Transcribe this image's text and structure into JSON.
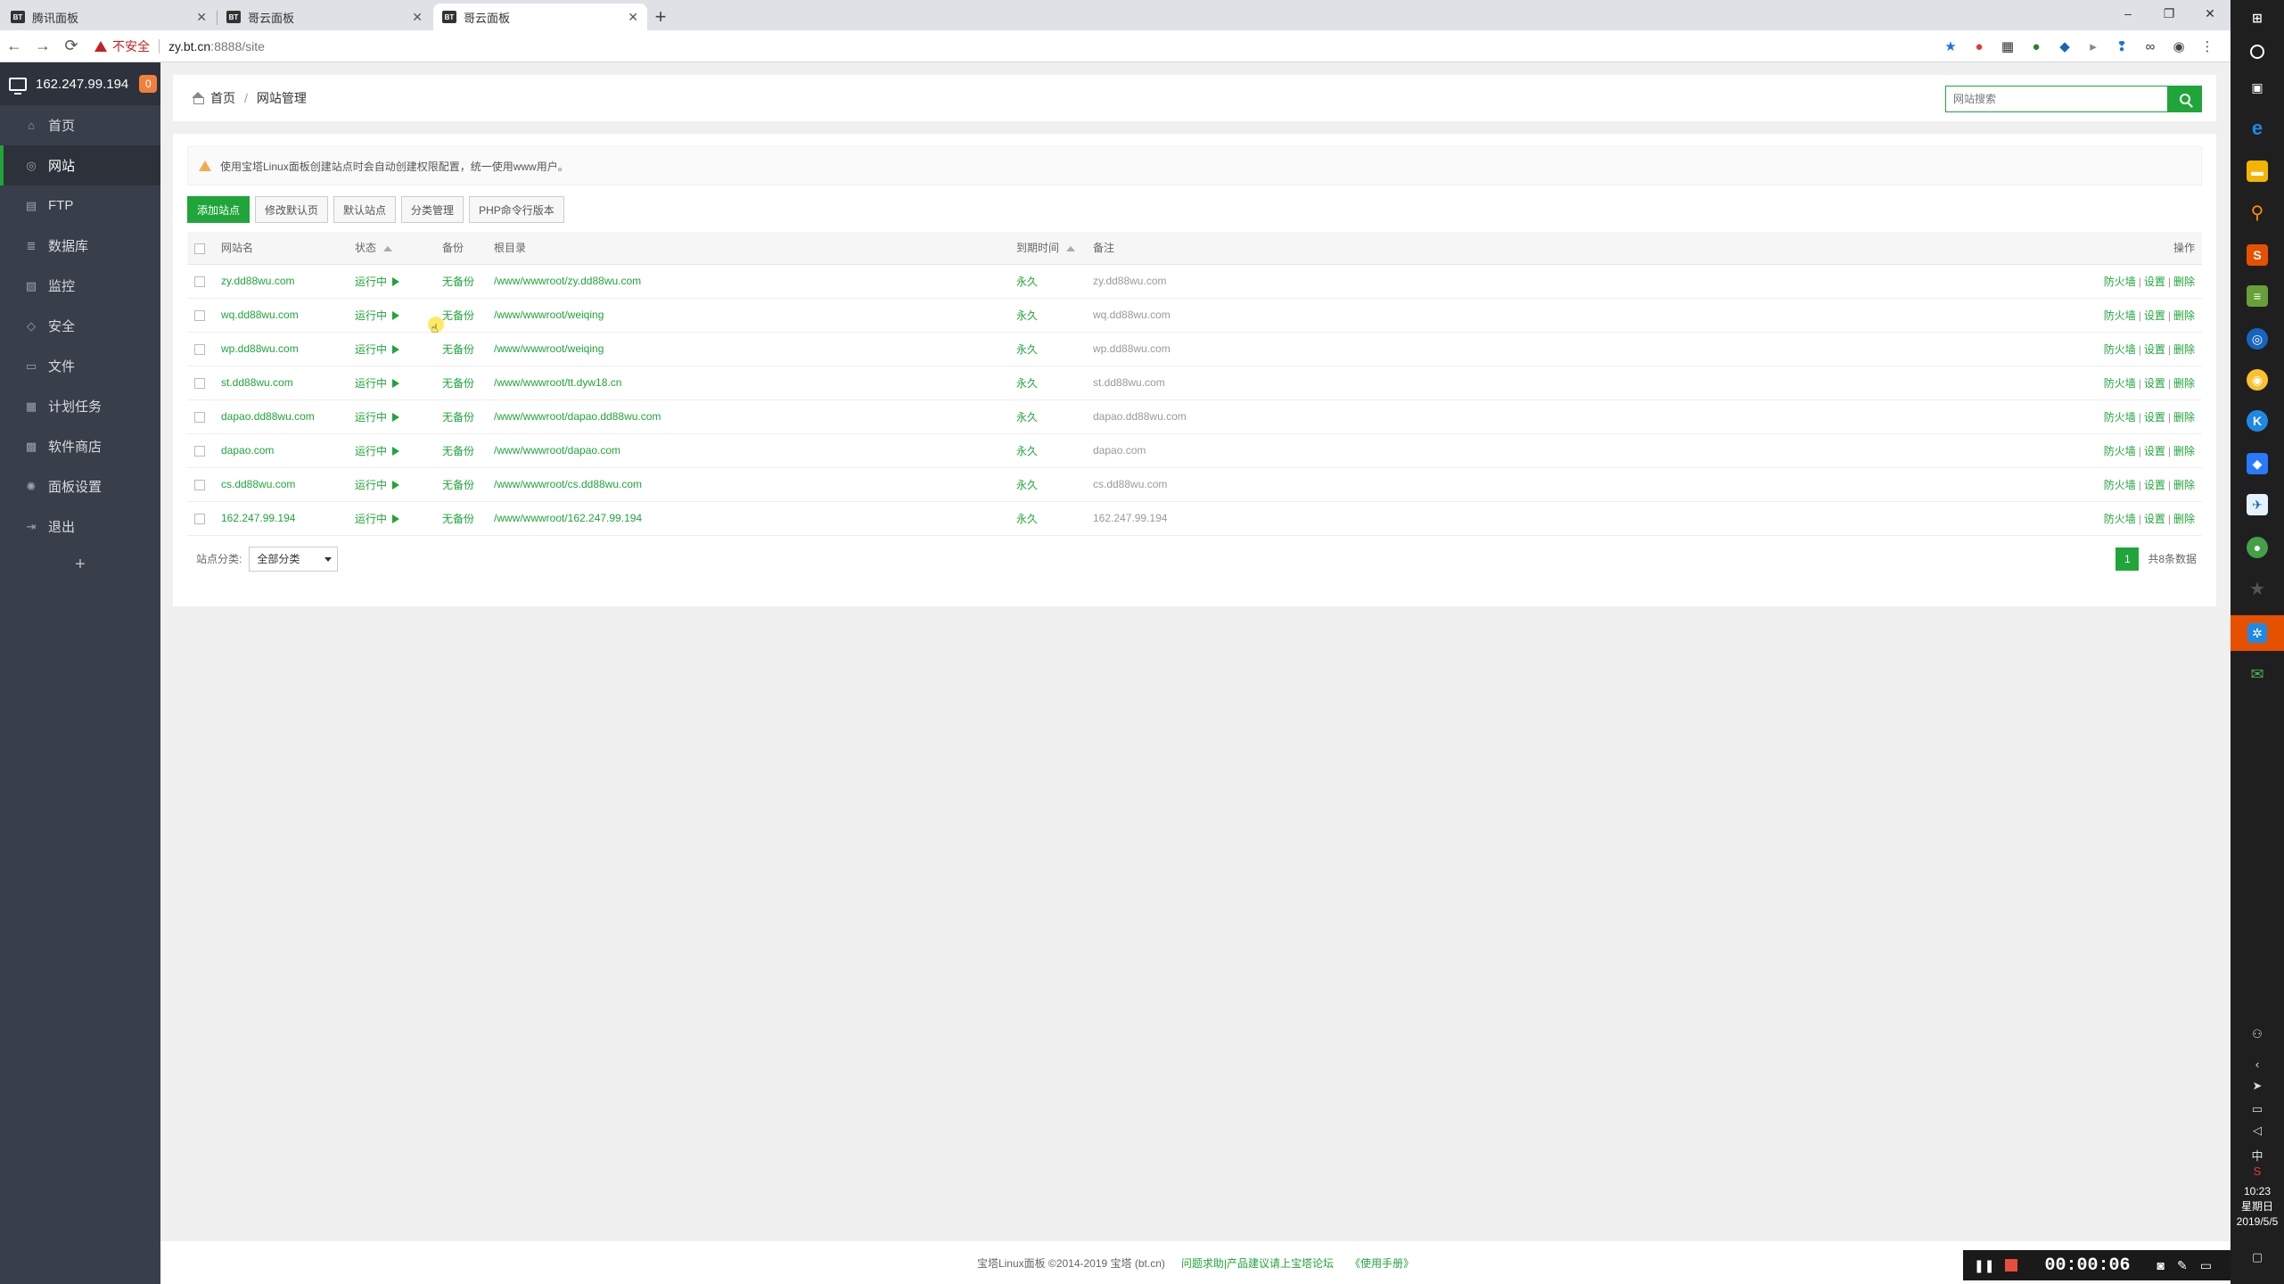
{
  "browser": {
    "tabs": [
      {
        "favicon": "BT",
        "label": "腾讯面板"
      },
      {
        "favicon": "BT",
        "label": "哥云面板"
      },
      {
        "favicon": "BT",
        "label": "哥云面板"
      }
    ],
    "new_tab": "+",
    "controls": {
      "minimize": "–",
      "restore": "❐",
      "close": "✕"
    },
    "nav": {
      "back": "←",
      "forward": "→",
      "reload": "⟳"
    },
    "security": "不安全",
    "url_host": "zy.bt.cn",
    "url_path": ":8888/site",
    "extensions": [
      "★",
      "●",
      "▦",
      "●",
      "◆",
      "▸",
      "❢",
      "∞",
      "◉",
      "⋮"
    ]
  },
  "sidebar": {
    "server_ip": "162.247.99.194",
    "badge": "0",
    "items": [
      {
        "icon": "⌂",
        "label": "首页"
      },
      {
        "icon": "◎",
        "label": "网站"
      },
      {
        "icon": "▤",
        "label": "FTP"
      },
      {
        "icon": "≣",
        "label": "数据库"
      },
      {
        "icon": "▨",
        "label": "监控"
      },
      {
        "icon": "◇",
        "label": "安全"
      },
      {
        "icon": "▭",
        "label": "文件"
      },
      {
        "icon": "▦",
        "label": "计划任务"
      },
      {
        "icon": "▩",
        "label": "软件商店"
      },
      {
        "icon": "✺",
        "label": "面板设置"
      },
      {
        "icon": "⇥",
        "label": "退出"
      }
    ],
    "add": "+"
  },
  "breadcrumb": {
    "home": "首页",
    "current": "网站管理"
  },
  "search": {
    "placeholder": "网站搜索"
  },
  "alert": {
    "text": "使用宝塔Linux面板创建站点时会自动创建权限配置，统一使用www用户。"
  },
  "toolbar": {
    "add_site": "添加站点",
    "modify_default": "修改默认页",
    "default_site": "默认站点",
    "category": "分类管理",
    "php_cli": "PHP命令行版本"
  },
  "table": {
    "headers": {
      "name": "网站名",
      "status": "状态",
      "backup": "备份",
      "root": "根目录",
      "expire": "到期时间",
      "note": "备注",
      "ops": "操作"
    },
    "ops": {
      "firewall": "防火墙",
      "settings": "设置",
      "delete": "删除"
    },
    "rows": [
      {
        "name": "zy.dd88wu.com",
        "status": "运行中",
        "backup": "无备份",
        "root": "/www/wwwroot/zy.dd88wu.com",
        "expire": "永久",
        "note": "zy.dd88wu.com"
      },
      {
        "name": "wq.dd88wu.com",
        "status": "运行中",
        "backup": "无备份",
        "root": "/www/wwwroot/weiqing",
        "expire": "永久",
        "note": "wq.dd88wu.com"
      },
      {
        "name": "wp.dd88wu.com",
        "status": "运行中",
        "backup": "无备份",
        "root": "/www/wwwroot/weiqing",
        "expire": "永久",
        "note": "wp.dd88wu.com"
      },
      {
        "name": "st.dd88wu.com",
        "status": "运行中",
        "backup": "无备份",
        "root": "/www/wwwroot/tt.dyw18.cn",
        "expire": "永久",
        "note": "st.dd88wu.com"
      },
      {
        "name": "dapao.dd88wu.com",
        "status": "运行中",
        "backup": "无备份",
        "root": "/www/wwwroot/dapao.dd88wu.com",
        "expire": "永久",
        "note": "dapao.dd88wu.com"
      },
      {
        "name": "dapao.com",
        "status": "运行中",
        "backup": "无备份",
        "root": "/www/wwwroot/dapao.com",
        "expire": "永久",
        "note": "dapao.com"
      },
      {
        "name": "cs.dd88wu.com",
        "status": "运行中",
        "backup": "无备份",
        "root": "/www/wwwroot/cs.dd88wu.com",
        "expire": "永久",
        "note": "cs.dd88wu.com"
      },
      {
        "name": "162.247.99.194",
        "status": "运行中",
        "backup": "无备份",
        "root": "/www/wwwroot/162.247.99.194",
        "expire": "永久",
        "note": "162.247.99.194"
      }
    ]
  },
  "footer": {
    "category_label": "站点分类:",
    "category_value": "全部分类",
    "page": "1",
    "total": "共8条数据"
  },
  "copyright": {
    "text": "宝塔Linux面板 ©2014-2019 宝塔 (bt.cn)",
    "forum_link": "问题求助|产品建议请上宝塔论坛",
    "manual_link": "《使用手册》"
  },
  "recorder": {
    "pause": "❚❚",
    "time": "00:00:06",
    "camera": "◙",
    "pen": "✎",
    "window": "▭"
  },
  "taskbar": {
    "clock_time": "10:23",
    "clock_day": "星期日",
    "clock_date": "2019/5/5",
    "ime": "中",
    "colors": {
      "brand_green": "#20a53a",
      "sidebar": "#383e4a",
      "badge": "#f0813c"
    }
  }
}
